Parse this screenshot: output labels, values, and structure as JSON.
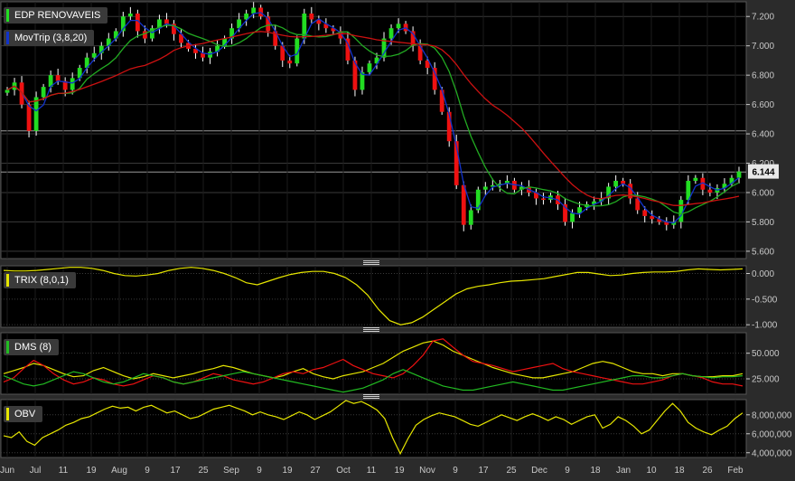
{
  "instrument": "EDP RENOVAVEIS",
  "last_price": "6.144",
  "colors": {
    "background": "#000000",
    "frame": "#2b2b2b",
    "grid": "#3a3a3a",
    "axis_text": "#c8c8c8",
    "up": "#22dd22",
    "down": "#ee1111",
    "wick": "#ffffff",
    "yellow": "#e6e600",
    "ma_fast": "#22aa22",
    "ma_slow": "#cc1111",
    "ma_fastest": "#1133cc"
  },
  "panels": {
    "price": {
      "legend": "EDP RENOVAVEIS",
      "legend2": "MovTrip (3,8,20)"
    },
    "trix": {
      "legend": "TRIX (8,0,1)"
    },
    "dms": {
      "legend": "DMS (8)"
    },
    "obv": {
      "legend": "OBV"
    }
  },
  "chart_data": [
    {
      "type": "candlestick",
      "title": "EDP RENOVAVEIS",
      "indicator": "MovTrip (3,8,20)",
      "x_tick_labels": [
        "Jun",
        "Jul",
        "11",
        "19",
        "Aug",
        "9",
        "17",
        "25",
        "Sep",
        "9",
        "19",
        "27",
        "Oct",
        "11",
        "19",
        "Nov",
        "9",
        "17",
        "25",
        "Dec",
        "9",
        "18",
        "Jan",
        "10",
        "18",
        "26",
        "Feb"
      ],
      "y_ticks": [
        "5.600",
        "5.800",
        "6.000",
        "6.200",
        "6.400",
        "6.600",
        "6.800",
        "7.000",
        "7.200"
      ],
      "ylim": [
        5.55,
        7.3
      ],
      "horizontal_lines": [
        6.42,
        6.14
      ],
      "last_value_label": "6.144",
      "close_series": [
        6.7,
        6.75,
        6.6,
        6.42,
        6.65,
        6.72,
        6.8,
        6.76,
        6.7,
        6.78,
        6.85,
        6.92,
        6.95,
        7.0,
        7.05,
        7.1,
        7.2,
        7.22,
        7.1,
        7.05,
        7.12,
        7.18,
        7.15,
        7.08,
        7.02,
        6.98,
        6.95,
        6.92,
        6.96,
        7.0,
        7.05,
        7.12,
        7.18,
        7.22,
        7.26,
        7.2,
        7.1,
        7.0,
        6.9,
        6.88,
        7.05,
        7.22,
        7.18,
        7.15,
        7.12,
        7.1,
        7.05,
        6.9,
        6.7,
        6.82,
        6.88,
        6.92,
        7.05,
        7.12,
        7.15,
        7.1,
        7.0,
        6.9,
        6.85,
        6.7,
        6.55,
        6.35,
        6.05,
        5.78,
        5.88,
        6.02,
        6.04,
        6.05,
        6.06,
        6.08,
        6.02,
        6.04,
        6.0,
        5.96,
        5.95,
        5.98,
        5.92,
        5.8,
        5.86,
        5.9,
        5.92,
        5.94,
        5.96,
        6.04,
        6.08,
        6.06,
        5.96,
        5.88,
        5.84,
        5.82,
        5.8,
        5.78,
        5.8,
        5.95,
        6.08,
        6.1,
        6.02,
        6.0,
        6.03,
        6.06,
        6.1,
        6.144
      ],
      "moving_averages": {
        "periods": [
          3,
          8,
          20
        ]
      }
    },
    {
      "type": "line",
      "title": "TRIX (8,0,1)",
      "y_ticks": [
        "-1.000",
        "-0.500",
        "0.000"
      ],
      "ylim": [
        -1.05,
        0.15
      ],
      "values": [
        0.06,
        0.05,
        0.05,
        0.06,
        0.08,
        0.1,
        0.12,
        0.12,
        0.1,
        0.06,
        0.0,
        -0.04,
        -0.05,
        -0.03,
        0.0,
        0.06,
        0.1,
        0.12,
        0.1,
        0.06,
        0.0,
        -0.08,
        -0.18,
        -0.22,
        -0.15,
        -0.08,
        -0.02,
        0.02,
        0.04,
        0.04,
        0.0,
        -0.08,
        -0.22,
        -0.42,
        -0.7,
        -0.92,
        -1.0,
        -0.96,
        -0.85,
        -0.7,
        -0.55,
        -0.4,
        -0.3,
        -0.25,
        -0.22,
        -0.18,
        -0.15,
        -0.14,
        -0.12,
        -0.1,
        -0.06,
        -0.02,
        0.02,
        0.02,
        -0.01,
        -0.04,
        -0.03,
        0.0,
        0.02,
        0.03,
        0.03,
        0.04,
        0.07,
        0.09,
        0.08,
        0.07,
        0.08,
        0.09
      ]
    },
    {
      "type": "line",
      "title": "DMS (8)",
      "y_ticks": [
        "25.000",
        "50.000"
      ],
      "ylim": [
        10,
        70
      ],
      "series": [
        {
          "name": "",
          "color": "#e6e600",
          "values": [
            30,
            33,
            36,
            40,
            38,
            34,
            30,
            27,
            28,
            33,
            36,
            32,
            28,
            25,
            27,
            30,
            28,
            26,
            28,
            30,
            33,
            35,
            38,
            36,
            33,
            30,
            28,
            26,
            28,
            32,
            35,
            30,
            27,
            25,
            28,
            30,
            32,
            36,
            40,
            46,
            52,
            56,
            60,
            62,
            58,
            52,
            48,
            44,
            40,
            36,
            33,
            30,
            28,
            26,
            26,
            28,
            30,
            32,
            36,
            40,
            42,
            40,
            36,
            32,
            30,
            30,
            28,
            30,
            30,
            28,
            27,
            27,
            28,
            28,
            30
          ]
        },
        {
          "name": "",
          "color": "#ee1111",
          "values": [
            22,
            26,
            35,
            43,
            38,
            30,
            24,
            20,
            22,
            26,
            24,
            20,
            18,
            20,
            24,
            28,
            26,
            22,
            20,
            22,
            26,
            30,
            28,
            24,
            22,
            20,
            22,
            26,
            30,
            32,
            30,
            34,
            36,
            40,
            44,
            38,
            34,
            30,
            28,
            26,
            30,
            38,
            48,
            62,
            64,
            56,
            48,
            42,
            40,
            38,
            35,
            32,
            34,
            36,
            38,
            40,
            35,
            32,
            30,
            28,
            26,
            24,
            22,
            20,
            20,
            22,
            24,
            28,
            30,
            28,
            26,
            22,
            20,
            20,
            18
          ]
        },
        {
          "name": "",
          "color": "#22bb22",
          "values": [
            28,
            24,
            20,
            18,
            20,
            24,
            28,
            32,
            30,
            26,
            22,
            20,
            22,
            26,
            30,
            28,
            26,
            22,
            20,
            22,
            24,
            26,
            28,
            30,
            32,
            30,
            28,
            26,
            24,
            22,
            20,
            18,
            16,
            14,
            12,
            14,
            16,
            20,
            24,
            30,
            34,
            30,
            26,
            22,
            18,
            16,
            14,
            14,
            16,
            18,
            20,
            22,
            20,
            18,
            16,
            14,
            14,
            16,
            18,
            20,
            22,
            24,
            26,
            28,
            28,
            26,
            26,
            28,
            30,
            28,
            27,
            26,
            27,
            27,
            28
          ]
        }
      ]
    },
    {
      "type": "line",
      "title": "OBV",
      "y_ticks": [
        "4,000,000",
        "6,000,000",
        "8,000,000"
      ],
      "ylim": [
        3500000,
        9600000
      ],
      "values": [
        5800000,
        5600000,
        6200000,
        5200000,
        4800000,
        5600000,
        6000000,
        6400000,
        6900000,
        7200000,
        7600000,
        7800000,
        8200000,
        8600000,
        8900000,
        8700000,
        8800000,
        8400000,
        8800000,
        9000000,
        8600000,
        8200000,
        8400000,
        8000000,
        7600000,
        7800000,
        8200000,
        8600000,
        8800000,
        9000000,
        8700000,
        8400000,
        8000000,
        8300000,
        8000000,
        7800000,
        7500000,
        7900000,
        8300000,
        8000000,
        7500000,
        7900000,
        8300000,
        8900000,
        9500000,
        9200000,
        9400000,
        9000000,
        8500000,
        7600000,
        5600000,
        3900000,
        5500000,
        6900000,
        7500000,
        7900000,
        8200000,
        8000000,
        7800000,
        7400000,
        7000000,
        6800000,
        7200000,
        7600000,
        8000000,
        7700000,
        7400000,
        7800000,
        8100000,
        7800000,
        7400000,
        7800000,
        7500000,
        7000000,
        7400000,
        7800000,
        8000000,
        6600000,
        7000000,
        7800000,
        7400000,
        6800000,
        6000000,
        6400000,
        7400000,
        8400000,
        9200000,
        8400000,
        7200000,
        6600000,
        6200000,
        5900000,
        6400000,
        6800000,
        7600000,
        8200000
      ]
    }
  ]
}
